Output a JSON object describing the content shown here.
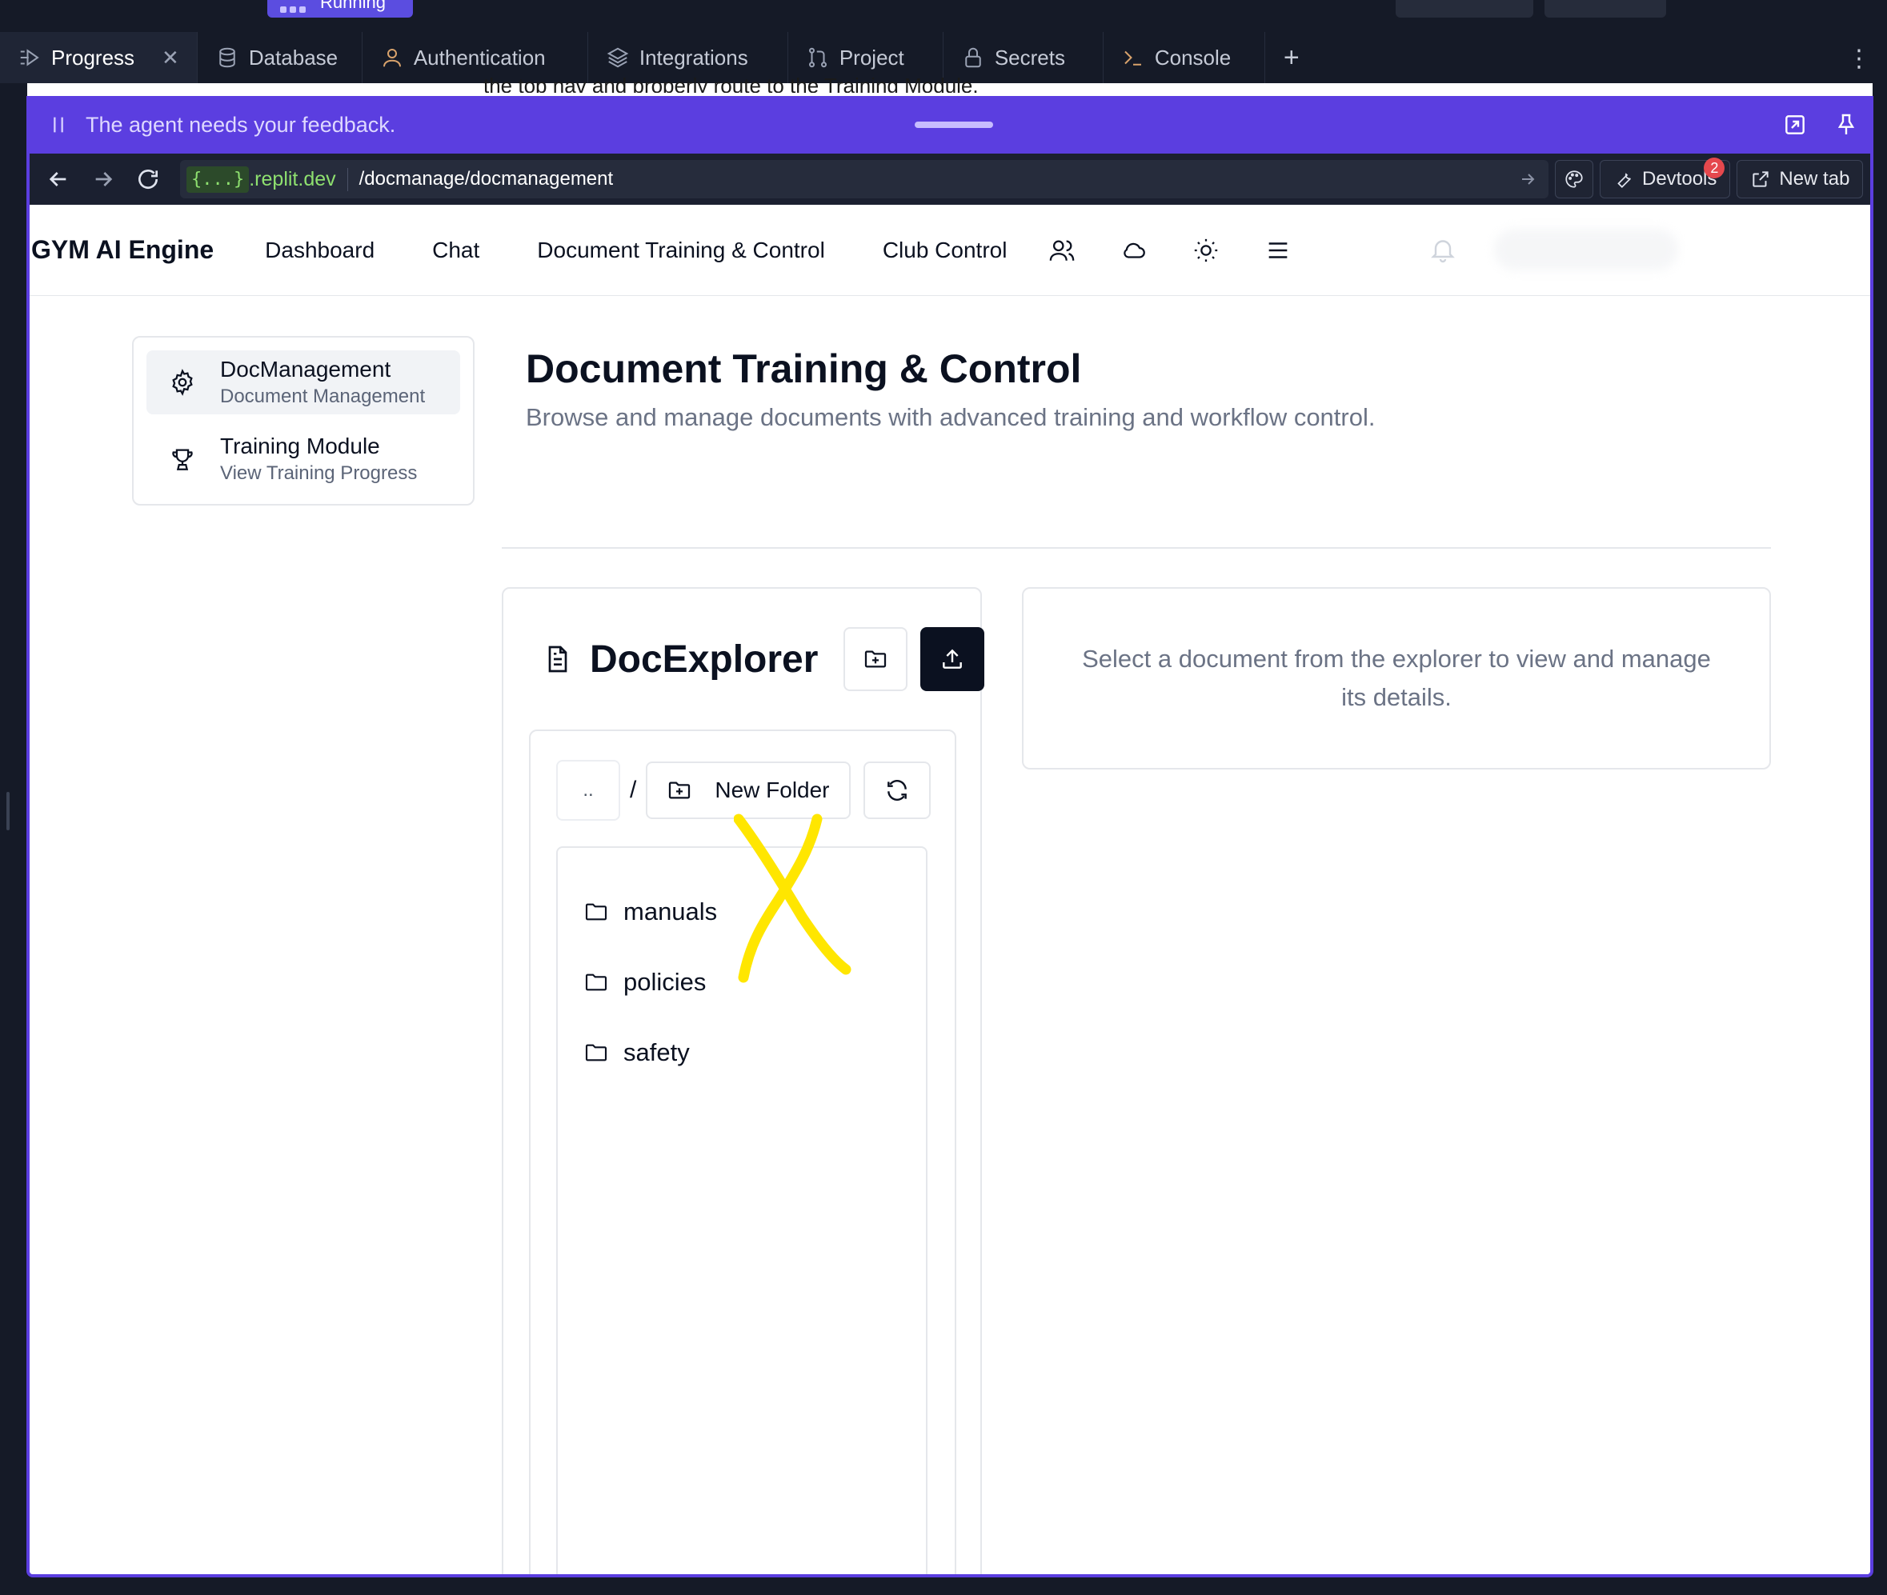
{
  "top": {
    "run_label": "Running"
  },
  "workspace_tabs": [
    {
      "label": "Progress",
      "icon": "progress-icon"
    },
    {
      "label": "Database",
      "icon": "database-icon"
    },
    {
      "label": "Authentication",
      "icon": "user-icon"
    },
    {
      "label": "Integrations",
      "icon": "layers-icon"
    },
    {
      "label": "Project",
      "icon": "git-icon"
    },
    {
      "label": "Secrets",
      "icon": "lock-icon"
    },
    {
      "label": "Console",
      "icon": "terminal-icon"
    }
  ],
  "behind_text": "the top nav and properly route to the Training Module.",
  "feedback": {
    "text": "The agent needs your feedback."
  },
  "browser": {
    "domain_chip": "{...}",
    "domain": ".replit.dev",
    "path": "/docmanage/docmanagement",
    "devtools_label": "Devtools",
    "devtools_badge": "2",
    "newtab_label": "New tab"
  },
  "app": {
    "brand": "GYM AI Engine",
    "nav": [
      "Dashboard",
      "Chat",
      "Document Training & Control",
      "Club Control"
    ],
    "sidebar": [
      {
        "title": "DocManagement",
        "subtitle": "Document Management",
        "icon": "gear-icon"
      },
      {
        "title": "Training Module",
        "subtitle": "View Training Progress",
        "icon": "trophy-icon"
      }
    ],
    "page_title": "Document Training & Control",
    "page_subtitle": "Browse and manage documents with advanced training and workflow control.",
    "explorer": {
      "title": "DocExplorer",
      "up_label": "..",
      "separator": "/",
      "new_folder_label": "New Folder",
      "folders": [
        "manuals",
        "policies",
        "safety"
      ]
    },
    "details_placeholder": "Select a document from the explorer to view and manage its details."
  },
  "colors": {
    "feedback_bar": "#5b3ee0",
    "annotation": "#ffe600",
    "primary_dark": "#0b1120"
  }
}
